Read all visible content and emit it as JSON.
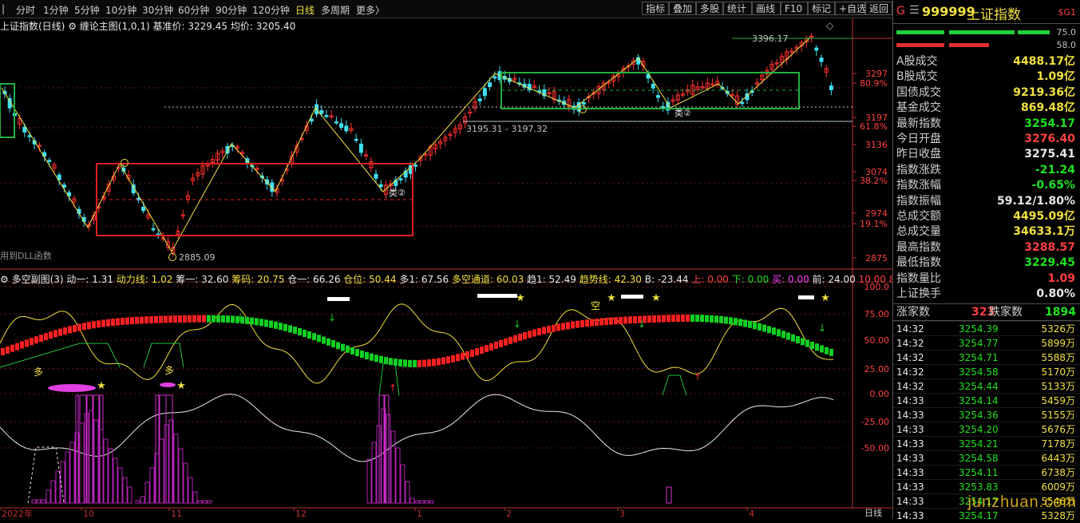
{
  "toolbar": {
    "periods": [
      "分时",
      "1分钟",
      "5分钟",
      "10分钟",
      "30分钟",
      "60分钟",
      "90分钟",
      "120分钟",
      "日线",
      "多周期",
      "更多"
    ],
    "more_suffix": "〉",
    "right_buttons": [
      "指标",
      "叠加",
      "多股",
      "统计",
      "画线",
      "F10",
      "标记",
      "+自选",
      "返回"
    ]
  },
  "main_info": {
    "title": "上证指数(日线)",
    "indicator": "缠论主图(1,0,1)",
    "base_label": "基准价: 3229.45",
    "avg_label": "均价: 3205.40",
    "diamond": "◇",
    "window_icons": "◇ ◆"
  },
  "annotations": {
    "high": "3396.17",
    "low": "2885.09",
    "range": "3195.31 - 3197.32",
    "class2_a": "类②",
    "class2_b": "类②",
    "dll": "用到DLL函数",
    "sub_duo": "多",
    "sub_kong": "空"
  },
  "axis_main": {
    "ticks": [
      {
        "v": "3297",
        "c": "#ff4040"
      },
      {
        "v": "80.9%",
        "c": "#ff4040"
      },
      {
        "v": "3197",
        "c": "#ff4040"
      },
      {
        "v": "61.8%",
        "c": "#ff4040"
      },
      {
        "v": "3136",
        "c": "#ff4040"
      },
      {
        "v": "3074",
        "c": "#ff4040"
      },
      {
        "v": "38.2%",
        "c": "#ff4040"
      },
      {
        "v": "2974",
        "c": "#ff4040"
      },
      {
        "v": "19.1%",
        "c": "#ff4040"
      },
      {
        "v": "2875",
        "c": "#ff4040"
      }
    ]
  },
  "axis_sub": {
    "ticks": [
      "100.0",
      "75.00",
      "50.00",
      "25.00",
      "0.00",
      "-25.00",
      "-50.00"
    ]
  },
  "sub_info": {
    "title": "多空副图(3)",
    "items": [
      {
        "t": "动一: 1.31",
        "c": "#e8e8e8"
      },
      {
        "t": "动力线: 1.02",
        "c": "#f0e040"
      },
      {
        "t": "筹一: 32.60",
        "c": "#e8e8e8"
      },
      {
        "t": "筹码: 20.75",
        "c": "#f0e040"
      },
      {
        "t": "仓一: 66.26",
        "c": "#e8e8e8"
      },
      {
        "t": "仓位: 50.44",
        "c": "#f0e040"
      },
      {
        "t": "多1: 67.56",
        "c": "#e8e8e8"
      },
      {
        "t": "多空通道: 60.03",
        "c": "#f0e040"
      },
      {
        "t": "趋1: 52.49",
        "c": "#e8e8e8"
      },
      {
        "t": "趋势线: 42.30",
        "c": "#f0e040"
      },
      {
        "t": "B: -23.44",
        "c": "#e8e8e8"
      },
      {
        "t": "上: 0.00",
        "c": "#ff4040"
      },
      {
        "t": "下: 0.00",
        "c": "#20e020"
      },
      {
        "t": "买: 0.00",
        "c": "#ff40ff"
      },
      {
        "t": "前: 24.00",
        "c": "#e8e8e8"
      },
      {
        "t": "10.00",
        "c": "#ff4040"
      },
      {
        "t": "8",
        "c": "#ff4040"
      }
    ]
  },
  "x_axis": {
    "labels": [
      "2022年",
      "10",
      "11",
      "12",
      "1",
      "2",
      "3",
      "4"
    ],
    "period": "日线"
  },
  "panel": {
    "g": "G",
    "menu": "☰",
    "code": "999999",
    "name": "上证指数",
    "badge": "$G1",
    "bar1_pct": "75.0",
    "bar2_pct": "58.0",
    "stats": [
      {
        "l": "A股成交",
        "v": "4488.17亿",
        "c": "#f0e040"
      },
      {
        "l": "B股成交",
        "v": "1.09亿",
        "c": "#f0e040"
      },
      {
        "l": "国债成交",
        "v": "9219.36亿",
        "c": "#f0e040"
      },
      {
        "l": "基金成交",
        "v": "869.48亿",
        "c": "#f0e040"
      },
      {
        "l": "最新指数",
        "v": "3254.17",
        "c": "#20e020"
      },
      {
        "l": "今日开盘",
        "v": "3276.40",
        "c": "#ff4040"
      },
      {
        "l": "昨日收盘",
        "v": "3275.41",
        "c": "#e8e8e8"
      },
      {
        "l": "指数涨跌",
        "v": "-21.24",
        "c": "#20e020"
      },
      {
        "l": "指数涨幅",
        "v": "-0.65%",
        "c": "#20e020"
      },
      {
        "l": "指数振幅",
        "v": "59.12/1.80%",
        "c": "#e8e8e8"
      },
      {
        "l": "总成交额",
        "v": "4495.09亿",
        "c": "#f0e040"
      },
      {
        "l": "总成交量",
        "v": "34633.1万",
        "c": "#f0e040"
      },
      {
        "l": "最高指数",
        "v": "3288.57",
        "c": "#ff4040"
      },
      {
        "l": "最低指数",
        "v": "3229.45",
        "c": "#20e020"
      },
      {
        "l": "指数量比",
        "v": "1.09",
        "c": "#ff4040"
      },
      {
        "l": "上证换手",
        "v": "0.80%",
        "c": "#e8e8e8"
      }
    ],
    "up_label": "涨家数",
    "up_count": "323",
    "down_label": "跌家数",
    "down_count": "1894",
    "ticks": [
      {
        "t": "14:32",
        "p": "3254.39",
        "v": "5326万"
      },
      {
        "t": "14:32",
        "p": "3254.77",
        "v": "5899万"
      },
      {
        "t": "14:32",
        "p": "3254.71",
        "v": "5588万"
      },
      {
        "t": "14:32",
        "p": "3254.58",
        "v": "5170万"
      },
      {
        "t": "14:32",
        "p": "3254.44",
        "v": "5133万"
      },
      {
        "t": "14:33",
        "p": "3254.14",
        "v": "5459万"
      },
      {
        "t": "14:33",
        "p": "3254.36",
        "v": "5155万"
      },
      {
        "t": "14:33",
        "p": "3254.20",
        "v": "5676万"
      },
      {
        "t": "14:33",
        "p": "3254.21",
        "v": "7178万"
      },
      {
        "t": "14:33",
        "p": "3254.58",
        "v": "6443万"
      },
      {
        "t": "14:33",
        "p": "3254.11",
        "v": "6738万"
      },
      {
        "t": "14:33",
        "p": "3253.83",
        "v": "6009万"
      },
      {
        "t": "14:33",
        "p": "3254.17",
        "v": "5546万"
      },
      {
        "t": "14:33",
        "p": "3254.17",
        "v": "5328万"
      }
    ],
    "watermark": "junzhuan.com"
  },
  "colors": {
    "up": "#ff3030",
    "down": "#40e0f0",
    "box_red": "#e02020",
    "box_green": "#20b040"
  }
}
